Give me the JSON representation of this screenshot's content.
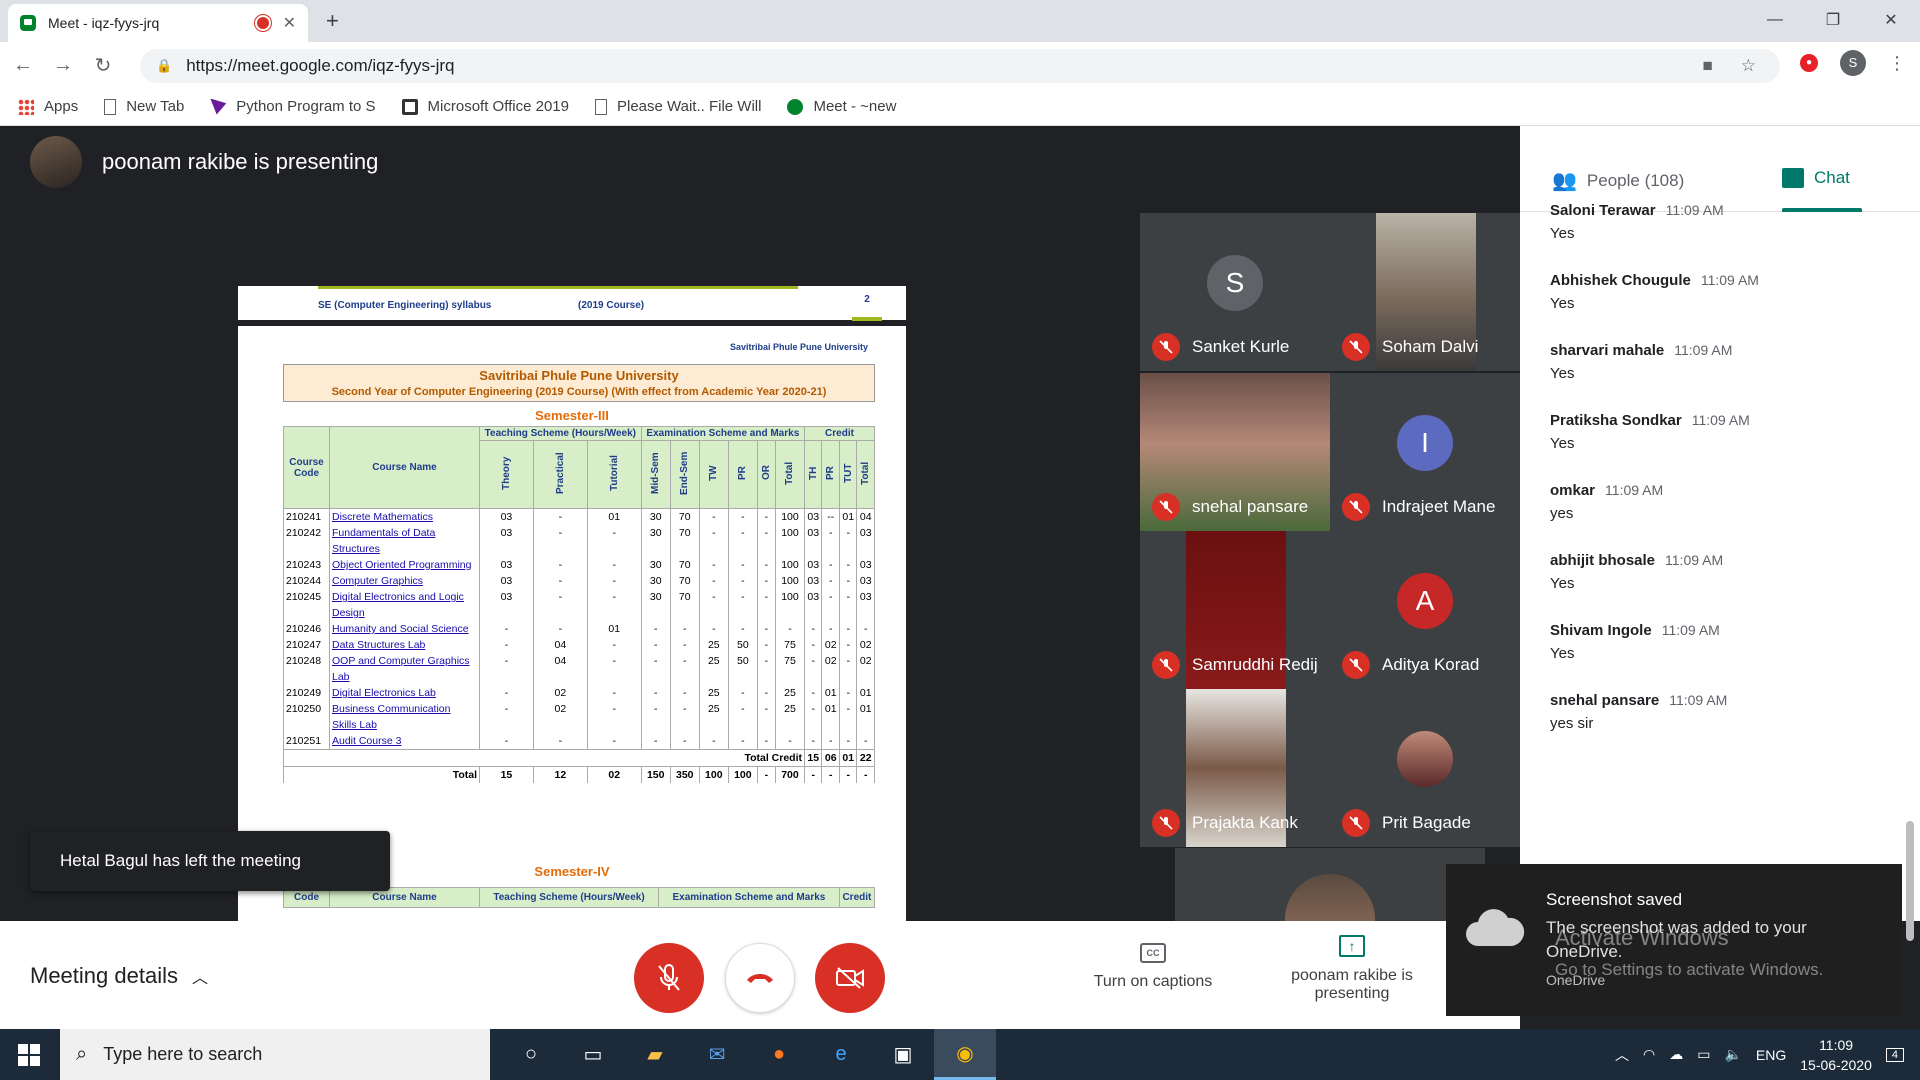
{
  "browser": {
    "tab_title": "Meet - iqz-fyys-jrq",
    "url": "https://meet.google.com/iqz-fyys-jrq",
    "profile_initial": "S",
    "bookmarks": [
      "Apps",
      "New Tab",
      "Python Program to S",
      "Microsoft Office 2019",
      "Please Wait.. File Will",
      "Meet - ~new"
    ]
  },
  "presenter": {
    "banner": "poonam rakibe is presenting"
  },
  "document": {
    "header_left": "SE (Computer Engineering) syllabus",
    "header_mid": "(2019 Course)",
    "page_no": "2",
    "university_top": "Savitribai Phule Pune University",
    "title": "Savitribai Phule Pune University",
    "subtitle": "Second Year of Computer Engineering (2019 Course)  (With effect from Academic Year 2020-21)",
    "semester3": "Semester-III",
    "semester4": "Semester-IV",
    "headers": {
      "code": "Course Code",
      "name": "Course  Name",
      "teaching": "Teaching Scheme (Hours/Week)",
      "exam": "Examination Scheme  and Marks",
      "credit": "Credit",
      "sub": [
        "Theory",
        "Practical",
        "Tutorial",
        "Mid-Sem",
        "End-Sem",
        "TW",
        "PR",
        "OR",
        "Total",
        "TH",
        "PR",
        "TUT",
        "Total"
      ]
    },
    "rows": [
      {
        "code": "210241",
        "name": "Discrete Mathematics",
        "v": [
          "03",
          "-",
          "01",
          "30",
          "70",
          "-",
          "-",
          "-",
          "100",
          "03",
          "--",
          "01",
          "04"
        ]
      },
      {
        "code": "210242",
        "name": "Fundamentals of Data Structures",
        "v": [
          "03",
          "-",
          "-",
          "30",
          "70",
          "-",
          "-",
          "-",
          "100",
          "03",
          "-",
          "-",
          "03"
        ]
      },
      {
        "code": "210243",
        "name": "Object Oriented Programming",
        "v": [
          "03",
          "-",
          "-",
          "30",
          "70",
          "-",
          "-",
          "-",
          "100",
          "03",
          "-",
          "-",
          "03"
        ]
      },
      {
        "code": "210244",
        "name": "Computer Graphics",
        "v": [
          "03",
          "-",
          "-",
          "30",
          "70",
          "-",
          "-",
          "-",
          "100",
          "03",
          "-",
          "-",
          "03"
        ]
      },
      {
        "code": "210245",
        "name": "Digital Electronics and Logic Design",
        "v": [
          "03",
          "-",
          "-",
          "30",
          "70",
          "-",
          "-",
          "-",
          "100",
          "03",
          "-",
          "-",
          "03"
        ]
      },
      {
        "code": "210246",
        "name": "Humanity and Social Science",
        "v": [
          "-",
          "-",
          "01",
          "-",
          "-",
          "-",
          "-",
          "-",
          "-",
          "-",
          "-",
          "-",
          "-"
        ]
      },
      {
        "code": "210247",
        "name": "Data Structures  Lab",
        "v": [
          "-",
          "04",
          "-",
          "-",
          "-",
          "25",
          "50",
          "-",
          "75",
          "-",
          "02",
          "-",
          "02"
        ]
      },
      {
        "code": "210248",
        "name": "OOP and Computer Graphics  Lab",
        "v": [
          "-",
          "04",
          "-",
          "-",
          "-",
          "25",
          "50",
          "-",
          "75",
          "-",
          "02",
          "-",
          "02"
        ]
      },
      {
        "code": "210249",
        "name": "Digital Electronics Lab",
        "v": [
          "-",
          "02",
          "-",
          "-",
          "-",
          "25",
          "-",
          "-",
          "25",
          "-",
          "01",
          "-",
          "01"
        ]
      },
      {
        "code": "210250",
        "name": "Business   Communication Skills Lab",
        "v": [
          "-",
          "02",
          "-",
          "-",
          "-",
          "25",
          "-",
          "-",
          "25",
          "-",
          "01",
          "-",
          "01"
        ]
      },
      {
        "code": "210251",
        "name": "Audit Course 3",
        "v": [
          "-",
          "-",
          "-",
          "-",
          "-",
          "-",
          "-",
          "-",
          "-",
          "-",
          "-",
          "-",
          "-"
        ]
      }
    ],
    "total_credit_label": "Total Credit",
    "total_credit_values": [
      "15",
      "06",
      "01",
      "22"
    ],
    "total_label": "Total",
    "total_values": [
      "15",
      "12",
      "02",
      "150",
      "350",
      "100",
      "100",
      "-",
      "700",
      "-",
      "-",
      "-",
      "-"
    ],
    "sem4_headers": {
      "code": "Code",
      "name": "Course Name",
      "teaching": "Teaching Scheme (Hours/Week)",
      "exam": "Examination Scheme  and Marks",
      "credit": "Credit"
    }
  },
  "toast": "Hetal Bagul has left the meeting",
  "participants": [
    {
      "name": "Sanket Kurle",
      "letter": "S",
      "color": "#5f6368"
    },
    {
      "name": "Soham Dalvi",
      "letter": "",
      "color": ""
    },
    {
      "name": "snehal pansare",
      "letter": "",
      "color": ""
    },
    {
      "name": "Indrajeet Mane",
      "letter": "I",
      "color": "#5c6bc0"
    },
    {
      "name": "Samruddhi Redij",
      "letter": "",
      "color": ""
    },
    {
      "name": "Aditya Korad",
      "letter": "A",
      "color": "#c62828"
    },
    {
      "name": "Prajakta Kank",
      "letter": "",
      "color": ""
    },
    {
      "name": "Prit Bagade",
      "letter": "",
      "color": ""
    }
  ],
  "panel": {
    "people_label": "People (108)",
    "chat_label": "Chat",
    "messages": [
      {
        "name": "Saloni Terawar",
        "time": "11:09 AM",
        "text": "Yes"
      },
      {
        "name": "Abhishek Chougule",
        "time": "11:09 AM",
        "text": "Yes"
      },
      {
        "name": "sharvari mahale",
        "time": "11:09 AM",
        "text": "Yes"
      },
      {
        "name": "Pratiksha Sondkar",
        "time": "11:09 AM",
        "text": "Yes"
      },
      {
        "name": "omkar",
        "time": "11:09 AM",
        "text": "yes"
      },
      {
        "name": "abhijit bhosale",
        "time": "11:09 AM",
        "text": "Yes"
      },
      {
        "name": "Shivam Ingole",
        "time": "11:09 AM",
        "text": "Yes"
      },
      {
        "name": "snehal pansare",
        "time": "11:09 AM",
        "text": "yes sir"
      }
    ]
  },
  "notification": {
    "title": "Screenshot saved",
    "body": "The screenshot was added to your OneDrive.",
    "source": "OneDrive",
    "watermark1": "Activate Windows",
    "watermark2": "Go to Settings to activate Windows."
  },
  "controls": {
    "meeting_details": "Meeting details",
    "captions": "Turn on captions",
    "presenting": "poonam rakibe is presenting"
  },
  "taskbar": {
    "search_placeholder": "Type here to search",
    "lang": "ENG",
    "time": "11:09",
    "date": "15-06-2020",
    "notif_count": "4"
  }
}
